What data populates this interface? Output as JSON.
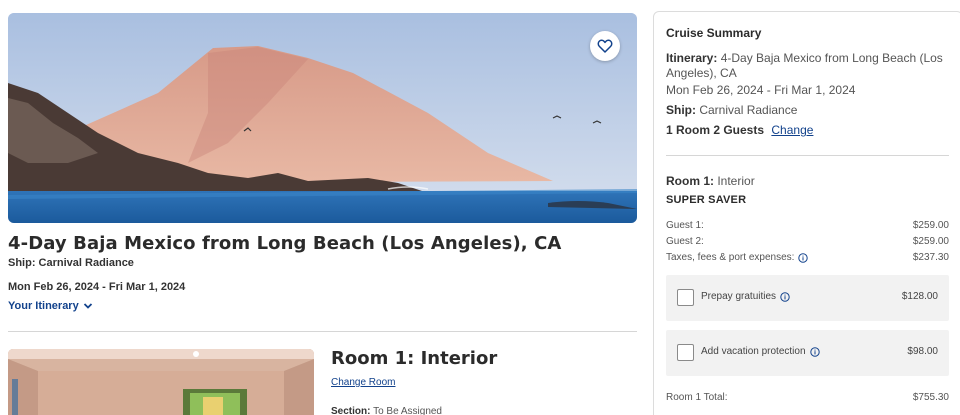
{
  "hero": {
    "favorite_icon": "heart-outline-icon"
  },
  "trip": {
    "title": "4-Day Baja Mexico from Long Beach (Los Angeles), CA",
    "ship": "Ship: Carnival Radiance",
    "dates": "Mon Feb 26, 2024 - Fri Mar 1, 2024",
    "itinerary_link": "Your Itinerary"
  },
  "room_card": {
    "title": "Room 1: Interior",
    "change_link": "Change Room",
    "section_label": "Section:",
    "section_value": "To Be Assigned"
  },
  "summary": {
    "heading": "Cruise Summary",
    "itinerary_label": "Itinerary:",
    "itinerary_value": "4-Day Baja Mexico from Long Beach (Los Angeles), CA",
    "dates": "Mon Feb 26, 2024 - Fri Mar 1, 2024",
    "ship_label": "Ship:",
    "ship_value": "Carnival Radiance",
    "rooms_guests": "1 Room 2 Guests",
    "change_link": "Change",
    "room_label": "Room 1:",
    "room_value": "Interior",
    "fare_type": "SUPER SAVER",
    "lines": [
      {
        "label": "Guest 1:",
        "amount": "$259.00"
      },
      {
        "label": "Guest 2:",
        "amount": "$259.00"
      },
      {
        "label": "Taxes, fees & port expenses:",
        "amount": "$237.30"
      }
    ],
    "options": [
      {
        "label": "Prepay gratuities",
        "amount": "$128.00",
        "checked": false
      },
      {
        "label": "Add vacation protection",
        "amount": "$98.00",
        "checked": false
      }
    ],
    "room_total_label": "Room 1 Total:",
    "room_total_amount": "$755.30"
  },
  "colors": {
    "link": "#12428c",
    "panel_border": "#dcdcdc",
    "option_bg": "#f2f2f2"
  }
}
